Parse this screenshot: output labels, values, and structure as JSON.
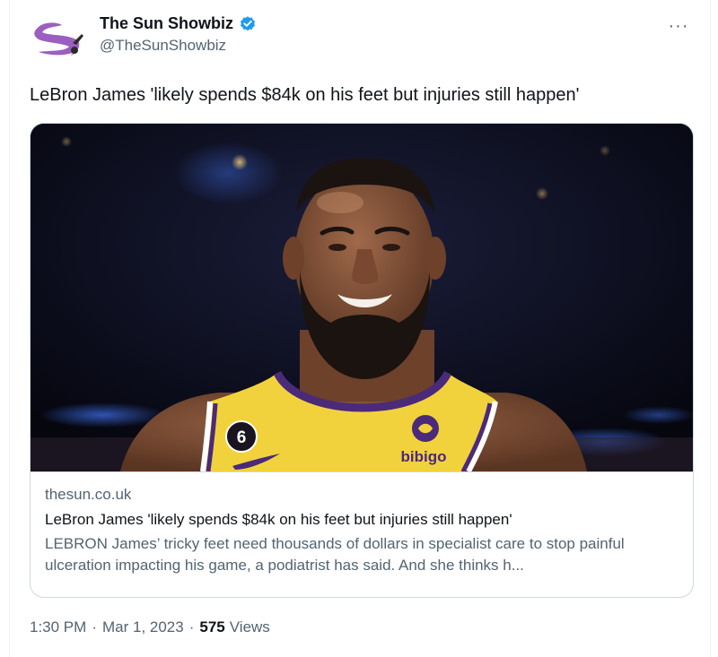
{
  "author": {
    "display_name": "The Sun Showbiz",
    "handle": "@TheSunShowbiz",
    "verified": true,
    "avatar_icon": "the-sun-showbiz-logo",
    "verified_icon": "verified-badge-icon"
  },
  "menu": {
    "more_label": "···"
  },
  "tweet": {
    "text": "LeBron James 'likely spends $84k on his feet but injuries still happen'"
  },
  "card": {
    "image_icon": "lebron-james-photo",
    "jersey_number": "6",
    "jersey_sponsor": "bibigo",
    "domain": "thesun.co.uk",
    "title": "LeBron James 'likely spends $84k on his feet but injuries still happen'",
    "description": "LEBRON James’ tricky feet need thousands of dollars in specialist care to stop painful ulceration impacting his game, a podiatrist has said. And she thinks h..."
  },
  "meta": {
    "time": "1:30 PM",
    "separator": "·",
    "date": "Mar 1, 2023",
    "views_count": "575",
    "views_label": "Views"
  },
  "colors": {
    "text_primary": "#0f1419",
    "text_secondary": "#536471",
    "border": "#cfd9de",
    "verified_blue": "#1d9bf0",
    "logo_purple": "#9b5fc0",
    "jersey_gold": "#f2d23c",
    "jersey_purple": "#4b2a7a"
  }
}
